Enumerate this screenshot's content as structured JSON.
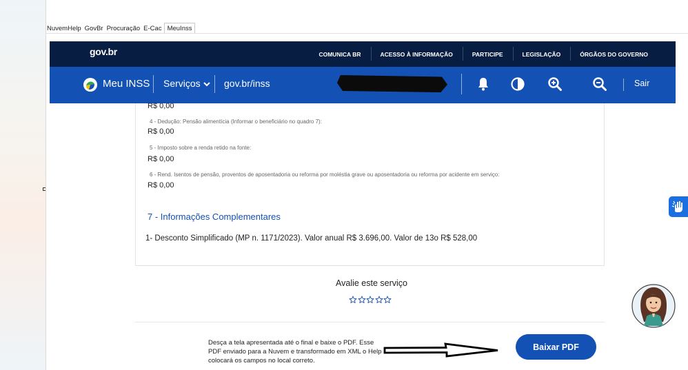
{
  "bookmarks": [
    {
      "label": "NuvemHelp"
    },
    {
      "label": "GovBr"
    },
    {
      "label": "Procuração"
    },
    {
      "label": "E-Cac"
    },
    {
      "label": "MeuInss"
    }
  ],
  "gov_header": {
    "logo": "gov.br",
    "nav": [
      "COMUNICA BR",
      "ACESSO À INFORMAÇÃO",
      "PARTICIPE",
      "LEGISLAÇÃO",
      "ÓRGÃOS DO GOVERNO"
    ]
  },
  "inss_header": {
    "title": "Meu INSS",
    "services": "Serviços",
    "link": "gov.br/inss",
    "logout": "Sair",
    "icons": [
      "notification-bell-icon",
      "contrast-icon",
      "zoom-in-icon",
      "zoom-out-icon"
    ]
  },
  "fields": [
    {
      "label": "",
      "value": "R$ 0,00"
    },
    {
      "label": "4 - Dedução: Pensão alimentícia (Informar o beneficiário no quadro 7):",
      "value": "R$ 0,00"
    },
    {
      "label": "5 - Imposto sobre a renda retido na fonte:",
      "value": "R$ 0,00"
    },
    {
      "label": "6 - Rend. Isentos de pensão, proventos de aposentadoria ou reforma por moléstia grave ou aposentadoria ou reforma por acidente em serviço:",
      "value": "R$ 0,00"
    }
  ],
  "section": {
    "title": "7 - Informações Complementares",
    "note": "1- Desconto Simplificado (MP n. 1171/2023). Valor anual R$ 3.696,00. Valor de 13o R$ 528,00"
  },
  "rating": {
    "title": "Avalie este serviço",
    "stars": 5,
    "selected": 0
  },
  "instructions": "Desça a tela apresentada até o final e baixe o PDF. Esse PDF enviado para a Nuvem e transformado em XML o Help colocará os campos no local correto.",
  "download_button": "Baixar PDF",
  "colors": {
    "gov_dark": "#071d41",
    "inss_blue": "#1351b4",
    "accessibility_blue": "#1b6fe0"
  }
}
